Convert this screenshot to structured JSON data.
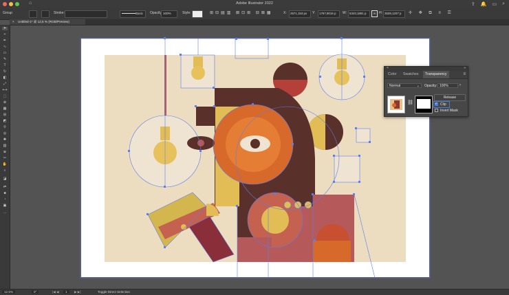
{
  "window": {
    "title": "Adobe Illustrator 2022"
  },
  "control_bar": {
    "selection": "Group",
    "stroke_label": "Stroke:",
    "brush": "Basic",
    "opacity_label": "Opacity:",
    "opacity_value": "100%",
    "style_label": "Style:",
    "x_value": "2571,153 px",
    "x_label": "X:",
    "y_label": "Y:",
    "y_value": "1767,9016 p",
    "w_label": "W:",
    "w_value": "5343,1891 p",
    "h_label": "H:",
    "h_value": "3539,1207 p"
  },
  "document_tab": {
    "label": "Untitled-1* @ 12,5 % (RGB/Preview)"
  },
  "status_bar": {
    "zoom": "12.5%",
    "rotation": "0°",
    "artboard": "1",
    "tool": "Toggle Direct Selection"
  },
  "transparency_panel": {
    "tabs": [
      "Color",
      "Swatches",
      "Transparency"
    ],
    "blend_mode": "Normal",
    "opacity_label": "Opacity:",
    "opacity_value": "100%",
    "release_label": "Release",
    "clip_label": "Clip",
    "clip_checked": true,
    "invert_mask_label": "Invert Mask",
    "invert_mask_checked": false
  },
  "colors": {
    "accent": "#4b7bd6",
    "background": "#535353",
    "artboard": "#ffffff",
    "art_bg": "#ecdcc0",
    "brown": "#5a312a",
    "orange": "#d7692a",
    "mustard": "#e2bd56",
    "rose": "#b5595a",
    "cream": "#efe4d2",
    "selection": "#5b7ef0"
  }
}
